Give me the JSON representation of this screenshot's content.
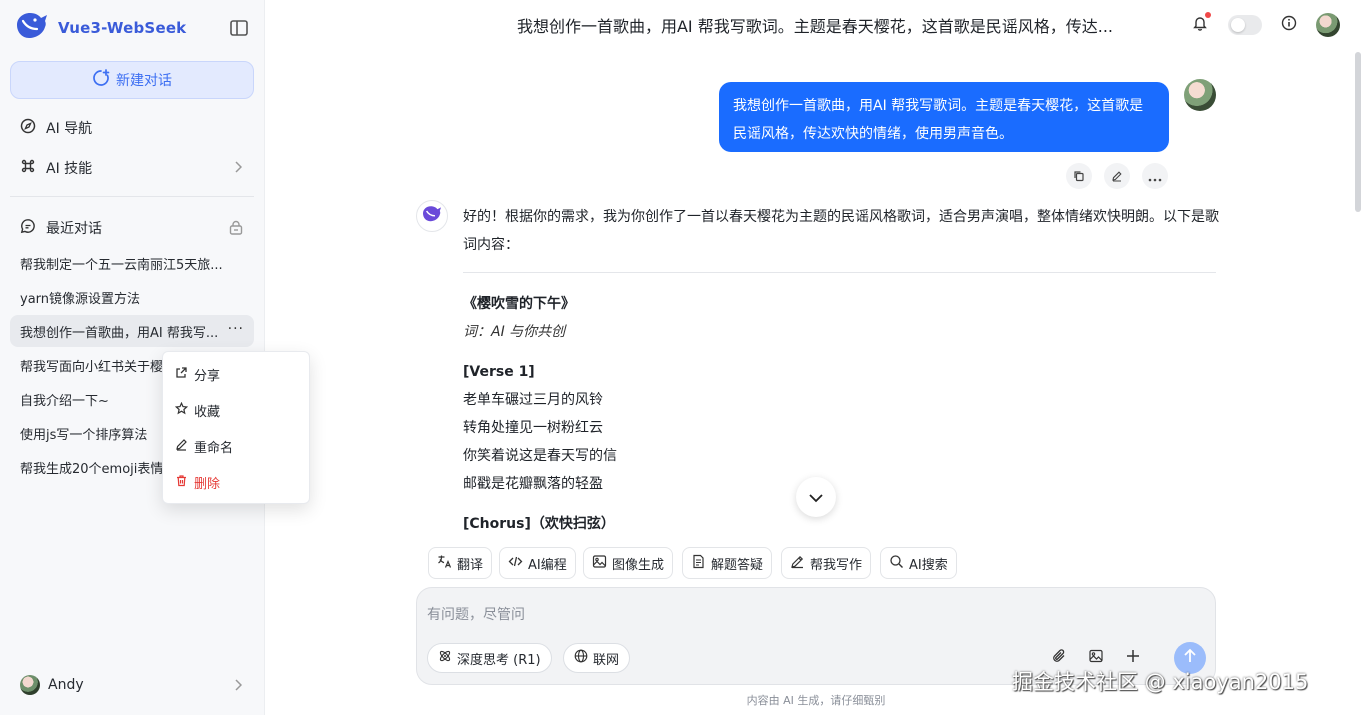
{
  "brand": {
    "name": "Vue3-WebSeek"
  },
  "sidebar": {
    "new_chat": "新建对话",
    "nav": [
      {
        "label": "AI 导航"
      },
      {
        "label": "AI 技能"
      }
    ],
    "recent_title": "最近对话",
    "conversations": [
      {
        "label": "帮我制定一个五一云南丽江5天旅..."
      },
      {
        "label": "yarn镜像源设置方法"
      },
      {
        "label": "我想创作一首歌曲，用AI 帮我写..."
      },
      {
        "label": "帮我写面向小红书关于樱"
      },
      {
        "label": "自我介绍一下~"
      },
      {
        "label": "使用js写一个排序算法"
      },
      {
        "label": "帮我生成20个emoji表情"
      }
    ],
    "more_label": "···",
    "user_name": "Andy"
  },
  "context_menu": {
    "items": [
      {
        "label": "分享"
      },
      {
        "label": "收藏"
      },
      {
        "label": "重命名"
      },
      {
        "label": "删除"
      }
    ]
  },
  "header": {
    "title": "我想创作一首歌曲，用AI 帮我写歌词。主题是春天樱花，这首歌是民谣风格，传达..."
  },
  "chat": {
    "user_message": "我想创作一首歌曲，用AI 帮我写歌词。主题是春天樱花，这首歌是民谣风格，传达欢快的情绪，使用男声音色。",
    "ai_intro": "好的！根据你的需求，我为你创作了一首以春天樱花为主题的民谣风格歌词，适合男声演唱，整体情绪欢快明朗。以下是歌词内容：",
    "song_title": "《樱吹雪的下午》",
    "lyricist": "词：AI 与你共创",
    "verse_label": "[Verse 1]",
    "verse_lines": [
      "老单车碾过三月的风铃",
      "转角处撞见一树粉红云",
      "你笑着说这是春天写的信",
      "邮戳是花瓣飘落的轻盈"
    ],
    "chorus_label": "[Chorus]",
    "chorus_note": "（欢快扫弦）"
  },
  "quick_actions": [
    {
      "label": "翻译"
    },
    {
      "label": "AI编程"
    },
    {
      "label": "图像生成"
    },
    {
      "label": "解题答疑"
    },
    {
      "label": "帮我写作"
    },
    {
      "label": "AI搜索"
    }
  ],
  "input": {
    "placeholder": "有问题，尽管问",
    "deep_think": "深度思考 (R1)",
    "web_search": "联网"
  },
  "footer_note": "内容由 AI 生成，请仔细甄别",
  "watermark": "掘金技术社区 @ xiaoyan2015",
  "colors": {
    "accent": "#1a6cff",
    "brand": "#3a5bd9",
    "danger": "#e53935"
  }
}
